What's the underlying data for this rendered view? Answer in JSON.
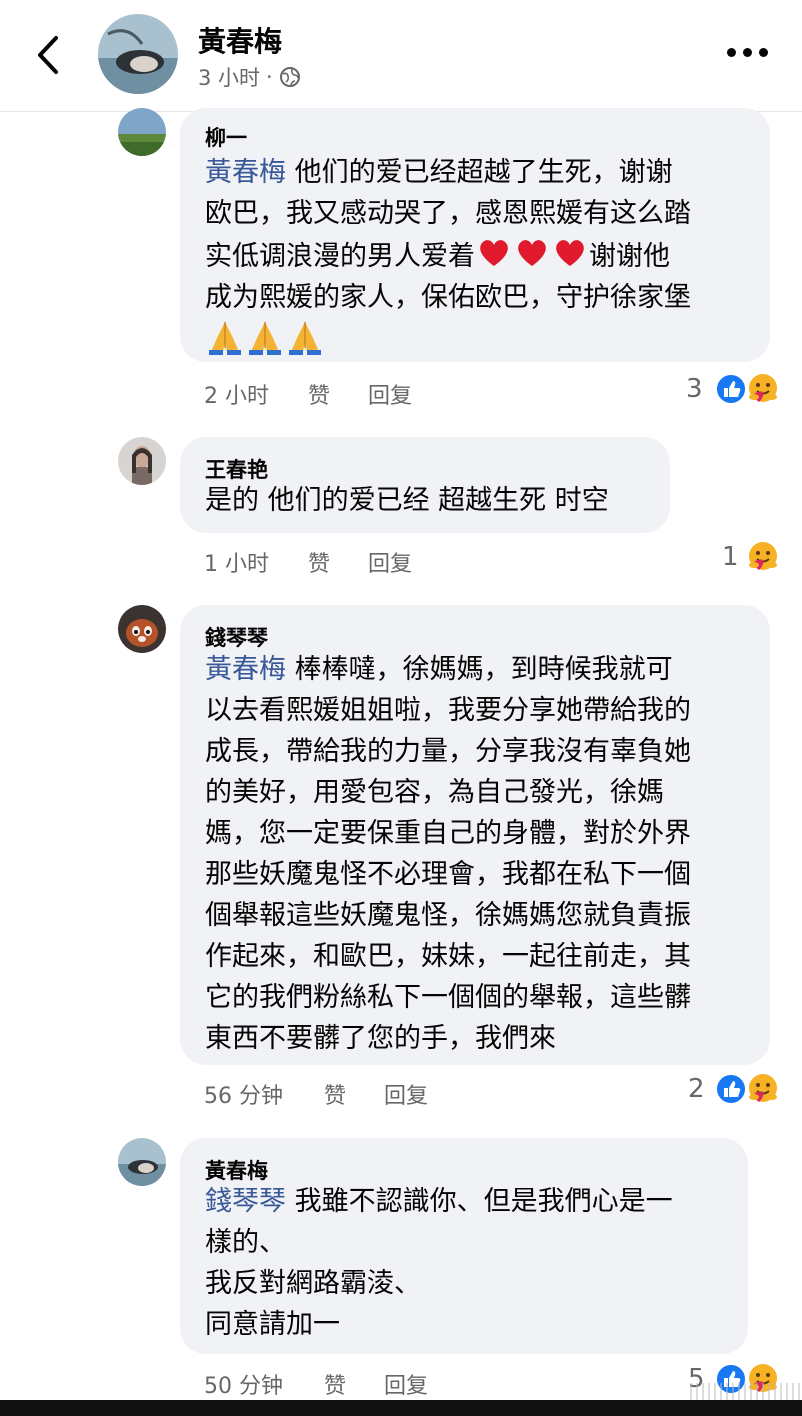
{
  "header": {
    "name": "黃春梅",
    "time": "3 小时",
    "dot": "·",
    "back_icon": "chevron-left-icon",
    "privacy_icon": "globe-icon",
    "more_icon": "more-dots-icon"
  },
  "comments": [
    {
      "author": "柳一",
      "mention": "黃春梅",
      "lines": [
        "他们的爱已经超越了生死，谢谢",
        "欧巴，我又感动哭了，感恩熙媛有这么踏",
        "实低调浪漫的男人爱着",
        "谢谢他",
        "成为熙媛的家人，保佑欧巴，守护徐家堡"
      ],
      "emoji": [
        "red-heart",
        "red-heart",
        "red-heart",
        "folded-hands",
        "folded-hands",
        "folded-hands"
      ],
      "time": "2 小时",
      "like": "赞",
      "reply": "回复",
      "reactions": "3"
    },
    {
      "author": "王春艳",
      "lines": [
        "是的 他们的爱已经 超越生死 时空"
      ],
      "time": "1 小时",
      "like": "赞",
      "reply": "回复",
      "reactions": "1"
    },
    {
      "author": "錢琴琴",
      "mention": "黃春梅",
      "lines": [
        "棒棒噠，徐媽媽，到時候我就可",
        "以去看熙媛姐姐啦，我要分享她帶給我的",
        "成長，帶給我的力量，分享我沒有辜負她",
        "的美好，用愛包容，為自己發光，徐媽",
        "媽，您一定要保重自己的身體，對於外界",
        "那些妖魔鬼怪不必理會，我都在私下一個",
        "個舉報這些妖魔鬼怪，徐媽媽您就負責振",
        "作起來，和歐巴，妹妹，一起往前走，其",
        "它的我們粉絲私下一個個的舉報，這些髒",
        "東西不要髒了您的手，我們來"
      ],
      "time": "56 分钟",
      "like": "赞",
      "reply": "回复",
      "reactions": "2"
    },
    {
      "author": "黃春梅",
      "mention": "錢琴琴",
      "lines": [
        "我雖不認識你、但是我們心是一",
        "樣的、",
        "我反對網路霸淩、",
        "同意請加一"
      ],
      "time": "50 分钟",
      "like": "赞",
      "reply": "回复",
      "reactions": "5"
    }
  ],
  "colors": {
    "bubble": "#f0f2f5",
    "mention": "#385898",
    "meta": "#65676b",
    "like_blue": "#1877f2",
    "care_yellow": "#f7b125"
  }
}
